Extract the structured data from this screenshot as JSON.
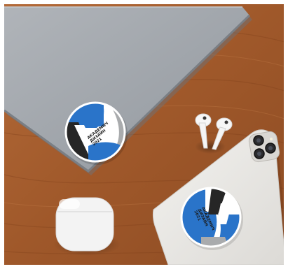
{
  "scene": {
    "background": "#ffffff",
    "table_color": "#a75e2f",
    "laptop_color": "#a4a8ae",
    "phone_case_color": "#e9e7e4",
    "earbuds_color": "#f7f7f7",
    "charging_case_color": "#f2f2f2"
  },
  "sticker": {
    "colors": {
      "blue": "#2a74c9",
      "white": "#ffffff",
      "gray": "#a9abad",
      "black": "#262626"
    },
    "text_lines": [
      "АКАДЕМИЧ",
      "ДИЗАЙН",
      "2021"
    ]
  }
}
